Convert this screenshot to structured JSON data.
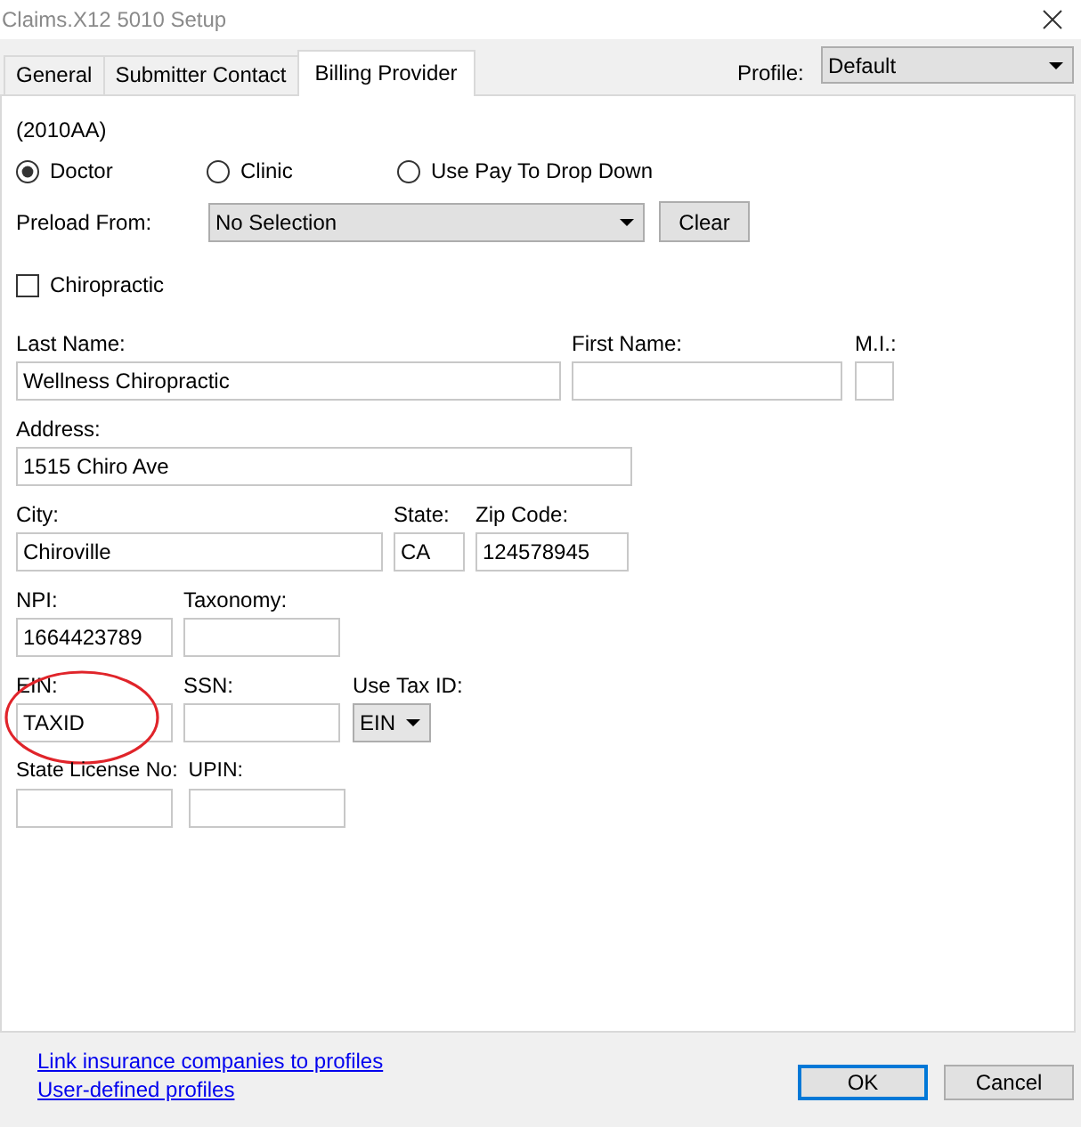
{
  "window": {
    "title": "Claims.X12 5010 Setup"
  },
  "tabs": [
    {
      "label": "General",
      "selected": false
    },
    {
      "label": "Submitter Contact",
      "selected": false
    },
    {
      "label": "Billing Provider",
      "selected": true
    }
  ],
  "profile": {
    "label": "Profile:",
    "value": "Default"
  },
  "section_code": "(2010AA)",
  "radios": [
    {
      "label": "Doctor",
      "selected": true
    },
    {
      "label": "Clinic",
      "selected": false
    },
    {
      "label": "Use Pay To Drop Down",
      "selected": false
    }
  ],
  "preload": {
    "label": "Preload From:",
    "value": "No Selection",
    "button": "Clear"
  },
  "checkbox": {
    "label": "Chiropractic",
    "checked": false
  },
  "rows": [
    [
      {
        "kind": "text",
        "label": "Last Name:",
        "value": "Wellness Chiropractic"
      },
      {
        "kind": "text",
        "label": "First Name:"
      },
      {
        "kind": "text",
        "label": "M.I.:"
      }
    ],
    [
      {
        "kind": "text",
        "label": "Address:",
        "value": "1515 Chiro Ave"
      }
    ],
    [
      {
        "kind": "text",
        "label": "City:",
        "value": "Chiroville"
      },
      {
        "kind": "text",
        "label": "State:",
        "value": "CA"
      },
      {
        "kind": "text",
        "label": "Zip Code:",
        "value": "124578945"
      }
    ],
    [
      {
        "kind": "text",
        "label": "NPI:",
        "value": "1664423789"
      },
      {
        "kind": "text",
        "label": "Taxonomy:"
      }
    ],
    [
      {
        "kind": "text",
        "label": "EIN:",
        "value": "TAXID",
        "circled": true
      },
      {
        "kind": "text",
        "label": "SSN:"
      },
      {
        "kind": "select",
        "label": "Use Tax ID:",
        "value": "EIN"
      }
    ],
    [
      {
        "kind": "text",
        "label": "State License No:"
      },
      {
        "kind": "text",
        "label": "UPIN:"
      }
    ]
  ],
  "links": [
    "Link insurance companies to profiles",
    "User-defined profiles"
  ],
  "buttons": [
    {
      "label": "OK",
      "default": true
    },
    {
      "label": "Cancel",
      "default": false
    }
  ]
}
